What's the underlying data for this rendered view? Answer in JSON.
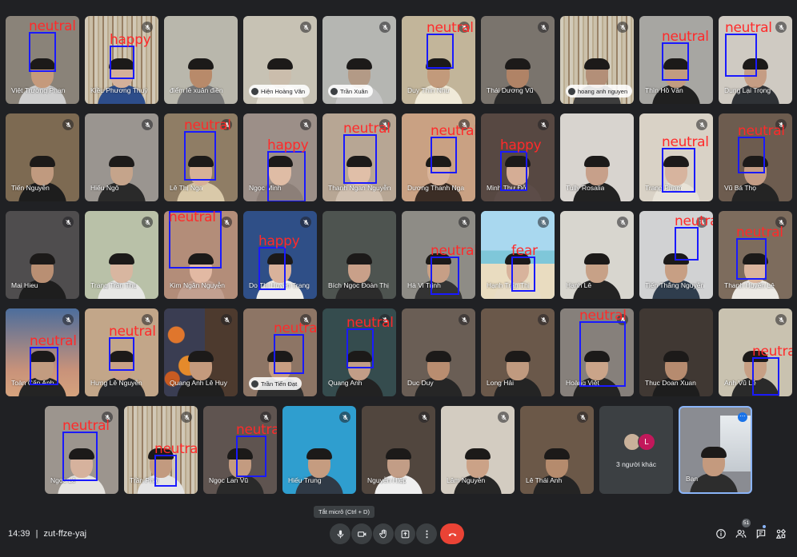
{
  "colors": {
    "background": "#202124",
    "face_box": "#1a1aff",
    "emotion_label": "#ff2a2a",
    "end_call": "#ea4335"
  },
  "tiles": [
    {
      "name": "Việt Trường Phan",
      "bg": "#8a8379",
      "skin": "#c59a7c",
      "shirt": "#cfcfcf",
      "muted": false,
      "emotion": "neutral"
    },
    {
      "name": "Kiều Phương Thuý",
      "bg": "#a89a7f",
      "skin": "#d4b09a",
      "shirt": "#2d4d8a",
      "muted": true,
      "emotion": "happy",
      "bookshelf": true
    },
    {
      "name": "điểm lê xuân điền",
      "bg": "#b9b7ac",
      "skin": "#b88a6a",
      "shirt": "#777",
      "muted": false
    },
    {
      "name": "Hiện Hoàng Văn",
      "bg": "#c7c2b4",
      "skin": "#cbbdac",
      "shirt": "#e2ddd2",
      "muted": true,
      "pill": true
    },
    {
      "name": "Trần Xuân",
      "bg": "#b5b6b2",
      "skin": "#b39a86",
      "shirt": "#c8c8c8",
      "muted": true,
      "pill": true
    },
    {
      "name": "Duy Thìn Như",
      "bg": "#c2b59a",
      "skin": "#c29a7b",
      "shirt": "#f0ead9",
      "muted": true,
      "emotion": "neutral"
    },
    {
      "name": "Thái Dương Vũ",
      "bg": "#7a746d",
      "skin": "#b08366",
      "shirt": "#2b2b2b",
      "muted": true
    },
    {
      "name": "hoang anh nguyen",
      "bg": "#ac9f87",
      "skin": "#b38f78",
      "shirt": "#3d3d3d",
      "muted": true,
      "pill": true,
      "bookshelf": true
    },
    {
      "name": "Thìn Hồ Văn",
      "bg": "#a7a6a2",
      "skin": "#c29c80",
      "shirt": "#202020",
      "muted": false,
      "emotion": "neutral"
    },
    {
      "name": "Dung Lại Trọng",
      "bg": "#cfcac2",
      "skin": "#c59d84",
      "shirt": "#2f3236",
      "muted": true,
      "emotion": "neutral"
    },
    {
      "name": "Tiến Nguyễn",
      "bg": "#7d6a52",
      "skin": "#c09a7f",
      "shirt": "#1d1d1d",
      "muted": true
    },
    {
      "name": "Hiếu Ngô",
      "bg": "#9a9590",
      "skin": "#c5a48b",
      "shirt": "#2a2a2a",
      "muted": true
    },
    {
      "name": "Lê Thị Nga",
      "bg": "#8f7d65",
      "skin": "#d6b197",
      "shirt": "#d9c9a9",
      "muted": true,
      "emotion": "neutral"
    },
    {
      "name": "Ngọc Minh",
      "bg": "#9c8f88",
      "skin": "#dfbca5",
      "shirt": "#8c7f78",
      "muted": true,
      "emotion": "happy"
    },
    {
      "name": "Thanh Ngan Nguyễn",
      "bg": "#b7a694",
      "skin": "#e0bfa8",
      "shirt": "#d0c0b0",
      "muted": true,
      "emotion": "neutral"
    },
    {
      "name": "Dương Thanh Nga",
      "bg": "#c9a183",
      "skin": "#d8b39a",
      "shirt": "#3b2d25",
      "muted": true,
      "emotion": "neutral"
    },
    {
      "name": "Minh Thư Đỗ",
      "bg": "#574842",
      "skin": "#d5ad95",
      "shirt": "#5c4c48",
      "muted": true,
      "emotion": "happy"
    },
    {
      "name": "Tully Rosalia",
      "bg": "#d8d4cf",
      "skin": "#c7a08a",
      "shirt": "#222",
      "muted": false
    },
    {
      "name": "Trang Phạm",
      "bg": "#d9d2c6",
      "skin": "#d7b49e",
      "shirt": "#e8e3d8",
      "muted": true,
      "emotion": "neutral"
    },
    {
      "name": "Vũ Bá Thọ",
      "bg": "#6d5c4f",
      "skin": "#c49d85",
      "shirt": "#242424",
      "muted": true,
      "emotion": "neutral"
    },
    {
      "name": "Mai Hieu",
      "bg": "#4f4d4e",
      "skin": "#b98f73",
      "shirt": "#1e1e1e",
      "muted": true
    },
    {
      "name": "Trang Trần Thu",
      "bg": "#b9c1a8",
      "skin": "#d8b6a0",
      "shirt": "#e7e7e5",
      "muted": true
    },
    {
      "name": "Kim Ngân Nguyễn",
      "bg": "#b38d79",
      "skin": "#e2b9a3",
      "shirt": "#c2a090",
      "muted": true,
      "emotion": "neutral"
    },
    {
      "name": "Do Thị Huyền Trang",
      "bg": "#2f4f87",
      "skin": "#d9b29b",
      "shirt": "#f0eee9",
      "muted": true,
      "emotion": "happy"
    },
    {
      "name": "Bích Ngọc Đoàn Thị",
      "bg": "#4e5450",
      "skin": "#c9a089",
      "shirt": "#2c2c2c",
      "muted": false
    },
    {
      "name": "Hà Vi Trịnh",
      "bg": "#8e8c86",
      "skin": "#c79f86",
      "shirt": "#333",
      "muted": true,
      "emotion": "neutral"
    },
    {
      "name": "Hạnh Trần Thị",
      "bg": "#9ed0e6",
      "skin": "#d8b39c",
      "shirt": "#e8dcc6",
      "muted": true,
      "emotion": "fear",
      "beach": true
    },
    {
      "name": "Hạnh Lê",
      "bg": "#d8d6cf",
      "skin": "#c7a187",
      "shirt": "#232323",
      "muted": true
    },
    {
      "name": "Tiến Thắng Nguyễn",
      "bg": "#d1d2d3",
      "skin": "#c79f84",
      "shirt": "#2f3d4d",
      "muted": true,
      "emotion": "neutral"
    },
    {
      "name": "Thanh Huyền Lê",
      "bg": "#7d6c5d",
      "skin": "#dab59e",
      "shirt": "#ece9e4",
      "muted": true,
      "emotion": "neutral"
    },
    {
      "name": "Toàn Cấn Anh",
      "bg": "#6d88a8",
      "skin": "#c29c80",
      "shirt": "#242424",
      "muted": true,
      "emotion": "neutral",
      "sunset": true
    },
    {
      "name": "Hưng Lê Nguyễn",
      "bg": "#c2a689",
      "skin": "#c9a186",
      "shirt": "#26272a",
      "muted": true,
      "emotion": "neutral"
    },
    {
      "name": "Quang Anh Lê Huy",
      "bg": "#4d3a2e",
      "skin": "#c49a7d",
      "shirt": "#1f1f1f",
      "muted": true,
      "autumn": true
    },
    {
      "name": "Trần Tiến Đạt",
      "bg": "#8d7565",
      "skin": "#c89e82",
      "shirt": "#2f2f2f",
      "muted": true,
      "emotion": "neutral",
      "pill": true
    },
    {
      "name": "Quang Anh",
      "bg": "#354c4e",
      "skin": "#c29d87",
      "shirt": "#222",
      "muted": true,
      "emotion": "neutral"
    },
    {
      "name": "Duc Duy",
      "bg": "#6a5e55",
      "skin": "#b98d70",
      "shirt": "#262626",
      "muted": true
    },
    {
      "name": "Long Hải",
      "bg": "#6a584a",
      "skin": "#c09a7f",
      "shirt": "#242424",
      "muted": true
    },
    {
      "name": "Hoàng Việt",
      "bg": "#86807b",
      "skin": "#caa489",
      "shirt": "#242424",
      "muted": true,
      "emotion": "neutral"
    },
    {
      "name": "Thuc Doan Xuan",
      "bg": "#403833",
      "skin": "#b68b6f",
      "shirt": "#1d1d1d",
      "muted": false
    },
    {
      "name": "Anh Vũ Lê",
      "bg": "#c9c2b0",
      "skin": "#c79f84",
      "shirt": "#2a2a2a",
      "muted": true,
      "emotion": "neutral"
    },
    {
      "name": "Ngọc Lê",
      "bg": "#9c958e",
      "skin": "#d6b29d",
      "shirt": "#e6e4e0",
      "muted": true,
      "emotion": "neutral"
    },
    {
      "name": "Trần Phái",
      "bg": "#a89a82",
      "skin": "#c29a7f",
      "shirt": "#e4e4e4",
      "muted": true,
      "emotion": "neutral",
      "bookshelf": true
    },
    {
      "name": "Ngọc Lan Vũ",
      "bg": "#5f5450",
      "skin": "#c39b80",
      "shirt": "#2a2a2a",
      "muted": true,
      "emotion": "neutral"
    },
    {
      "name": "Hiếu Trung",
      "bg": "#2f9ecf",
      "skin": "#c59c80",
      "shirt": "#303a46",
      "muted": true
    },
    {
      "name": "Nguyễn Hiệp",
      "bg": "#51463e",
      "skin": "#c29d86",
      "shirt": "#efefef",
      "muted": true
    },
    {
      "name": "Lâm Nguyễn",
      "bg": "#d3ccc1",
      "skin": "#cba287",
      "shirt": "#262626",
      "muted": true
    },
    {
      "name": "Lê Thái Anh",
      "bg": "#6b5848",
      "skin": "#b58b6d",
      "shirt": "#242424",
      "muted": true
    }
  ],
  "others_tile": {
    "label": "3 người khác",
    "avatar_letter": "L"
  },
  "self_tile": {
    "name": "Bạn"
  },
  "bottom_bar": {
    "time": "14:39",
    "separator": "|",
    "meeting_code": "zut-ffze-yaj",
    "tooltip": "Tắt micrô (Ctrl + D)",
    "participants_count": "51",
    "icons": [
      "mic-icon",
      "camera-icon",
      "raise-hand-icon",
      "present-icon",
      "more-options-icon",
      "end-call-icon",
      "info-icon",
      "people-icon",
      "chat-icon",
      "activities-icon"
    ]
  }
}
